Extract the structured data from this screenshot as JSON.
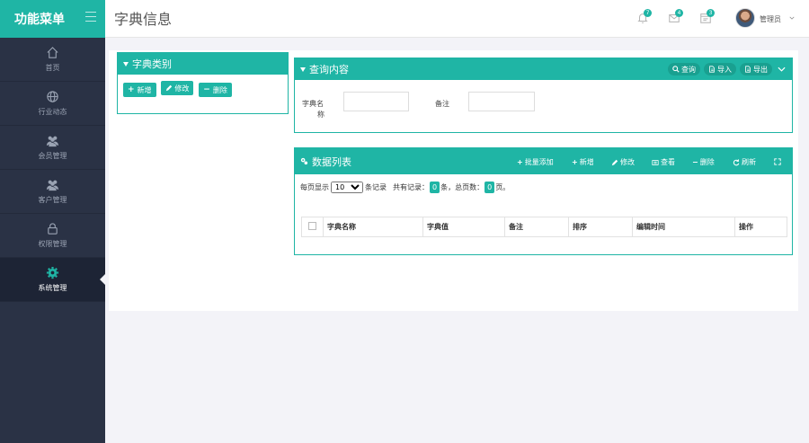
{
  "brand": {
    "title": "功能菜单"
  },
  "sidebar": {
    "items": [
      {
        "label": "首页",
        "icon": "home-icon"
      },
      {
        "label": "行业动态",
        "icon": "globe-icon"
      },
      {
        "label": "会员管理",
        "icon": "users-icon"
      },
      {
        "label": "客户管理",
        "icon": "users-icon"
      },
      {
        "label": "权限管理",
        "icon": "lock-icon"
      },
      {
        "label": "系统管理",
        "icon": "gear-icon",
        "active": true
      }
    ]
  },
  "header": {
    "page_title": "字典信息",
    "badges": {
      "bell": "7",
      "mail": "4",
      "tasks": "3"
    },
    "user": "管理员"
  },
  "category_panel": {
    "title": "字典类别",
    "buttons": {
      "add": "新增",
      "edit": "修改",
      "delete": "删除"
    }
  },
  "query_panel": {
    "title": "查询内容",
    "buttons": {
      "search": "查询",
      "import": "导入",
      "export": "导出"
    },
    "fields": {
      "name_label_1": "字典名",
      "name_label_2": "称",
      "name_value": "",
      "remark_label": "备注",
      "remark_value": ""
    }
  },
  "list_panel": {
    "title": "数据列表",
    "tools": {
      "batch_add": "批量添加",
      "add": "新增",
      "edit": "修改",
      "view": "查看",
      "delete": "删除",
      "refresh": "刷新"
    },
    "pager": {
      "per_page_prefix": "每页显示",
      "per_page_value": "10",
      "per_page_suffix": "条记录",
      "total_prefix": "共有记录：",
      "total_count": "0",
      "total_suffix": "条，总页数：",
      "page_count": "0",
      "page_suffix": "页。"
    },
    "columns": [
      "字典名称",
      "字典值",
      "备注",
      "排序",
      "编辑时间",
      "操作"
    ]
  },
  "colors": {
    "accent": "#1fb5a5",
    "sidebar": "#2a3245"
  }
}
